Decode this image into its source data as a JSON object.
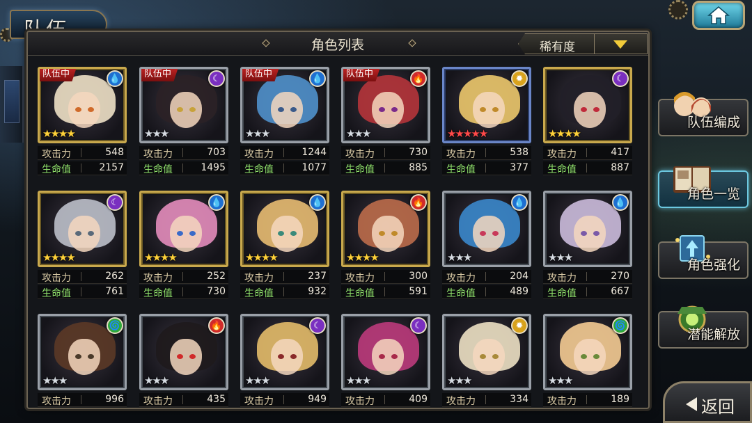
{
  "header": {
    "title": "队伍",
    "home": "home-icon"
  },
  "panel": {
    "title": "角色列表",
    "sort_label": "稀有度"
  },
  "stat_labels": {
    "atk": "攻击力",
    "hp": "生命值"
  },
  "team_tag": "队伍中",
  "element_colors": {
    "water": "#1e6fd0",
    "dark": "#7a2fc0",
    "fire": "#d02a2a",
    "light": "#d8a21c",
    "wind": "#2fa83a"
  },
  "element_glyphs": {
    "water": "💧",
    "dark": "☾",
    "fire": "🔥",
    "light": "✹",
    "wind": "🌀"
  },
  "characters": [
    {
      "in_team": true,
      "element": "water",
      "stars": 4,
      "star_color": "gold",
      "frame": "gold",
      "atk": "548",
      "hp": "2157",
      "hair": "#e9dcc2",
      "eye": "#d06a2a"
    },
    {
      "in_team": true,
      "element": "dark",
      "stars": 3,
      "star_color": "silver",
      "frame": "silver",
      "atk": "703",
      "hp": "1495",
      "hair": "#2b2226",
      "eye": "#c7a23a"
    },
    {
      "in_team": true,
      "element": "water",
      "stars": 3,
      "star_color": "silver",
      "frame": "silver",
      "atk": "1244",
      "hp": "1077",
      "hair": "#4e8ec8",
      "eye": "#3a5a8a"
    },
    {
      "in_team": true,
      "element": "fire",
      "stars": 3,
      "star_color": "silver",
      "frame": "silver",
      "atk": "730",
      "hp": "885",
      "hair": "#b2343a",
      "eye": "#7a2a8a"
    },
    {
      "in_team": false,
      "element": "light",
      "stars": 5,
      "star_color": "red",
      "frame": "blue",
      "atk": "538",
      "hp": "377",
      "hair": "#e8c46a",
      "eye": "#c08a2a"
    },
    {
      "in_team": false,
      "element": "dark",
      "stars": 4,
      "star_color": "gold",
      "frame": "gold",
      "atk": "417",
      "hp": "887",
      "hair": "#222028",
      "eye": "#c02a3a"
    },
    {
      "in_team": false,
      "element": "dark",
      "stars": 4,
      "star_color": "gold",
      "frame": "gold",
      "atk": "262",
      "hp": "761",
      "hair": "#b8bcc6",
      "eye": "#5a6a7a"
    },
    {
      "in_team": false,
      "element": "water",
      "stars": 4,
      "star_color": "gold",
      "frame": "gold",
      "atk": "252",
      "hp": "730",
      "hair": "#e08ab8",
      "eye": "#3a6ac8"
    },
    {
      "in_team": false,
      "element": "water",
      "stars": 4,
      "star_color": "gold",
      "frame": "gold",
      "atk": "237",
      "hp": "932",
      "hair": "#e3b870",
      "eye": "#3a8a7a"
    },
    {
      "in_team": false,
      "element": "fire",
      "stars": 4,
      "star_color": "gold",
      "frame": "gold",
      "atk": "300",
      "hp": "591",
      "hair": "#b86a4a",
      "eye": "#c08a2a"
    },
    {
      "in_team": false,
      "element": "water",
      "stars": 3,
      "star_color": "silver",
      "frame": "silver",
      "atk": "204",
      "hp": "489",
      "hair": "#3a86c8",
      "eye": "#c83a5a"
    },
    {
      "in_team": false,
      "element": "water",
      "stars": 3,
      "star_color": "silver",
      "frame": "silver",
      "atk": "270",
      "hp": "667",
      "hair": "#c8b8d8",
      "eye": "#7a5aa8"
    },
    {
      "in_team": false,
      "element": "wind",
      "stars": 3,
      "star_color": "silver",
      "frame": "silver",
      "atk": "996",
      "hp": "",
      "hair": "#5a3826",
      "eye": "#4a3a2a"
    },
    {
      "in_team": false,
      "element": "fire",
      "stars": 3,
      "star_color": "silver",
      "frame": "silver",
      "atk": "435",
      "hp": "",
      "hair": "#1e1a1c",
      "eye": "#d02a2a"
    },
    {
      "in_team": false,
      "element": "dark",
      "stars": 3,
      "star_color": "silver",
      "frame": "silver",
      "atk": "949",
      "hp": "",
      "hair": "#e0b868",
      "eye": "#8a2a2a"
    },
    {
      "in_team": false,
      "element": "dark",
      "stars": 3,
      "star_color": "silver",
      "frame": "silver",
      "atk": "409",
      "hp": "",
      "hair": "#b83a7a",
      "eye": "#a82a4a"
    },
    {
      "in_team": false,
      "element": "light",
      "stars": 3,
      "star_color": "silver",
      "frame": "silver",
      "atk": "334",
      "hp": "",
      "hair": "#e8dcc0",
      "eye": "#a88a3a"
    },
    {
      "in_team": false,
      "element": "wind",
      "stars": 3,
      "star_color": "silver",
      "frame": "silver",
      "atk": "189",
      "hp": "",
      "hair": "#f0c890",
      "eye": "#6a8a3a"
    }
  ],
  "side_menu": [
    {
      "label": "队伍编成",
      "icon": "party-faces-icon",
      "active": false
    },
    {
      "label": "角色一览",
      "icon": "book-icon",
      "active": true
    },
    {
      "label": "角色强化",
      "icon": "power-up-icon",
      "active": false
    },
    {
      "label": "潜能解放",
      "icon": "potential-orb-icon",
      "active": false
    }
  ],
  "back_button": {
    "label": "返回",
    "icon": "back-arrow-icon"
  }
}
